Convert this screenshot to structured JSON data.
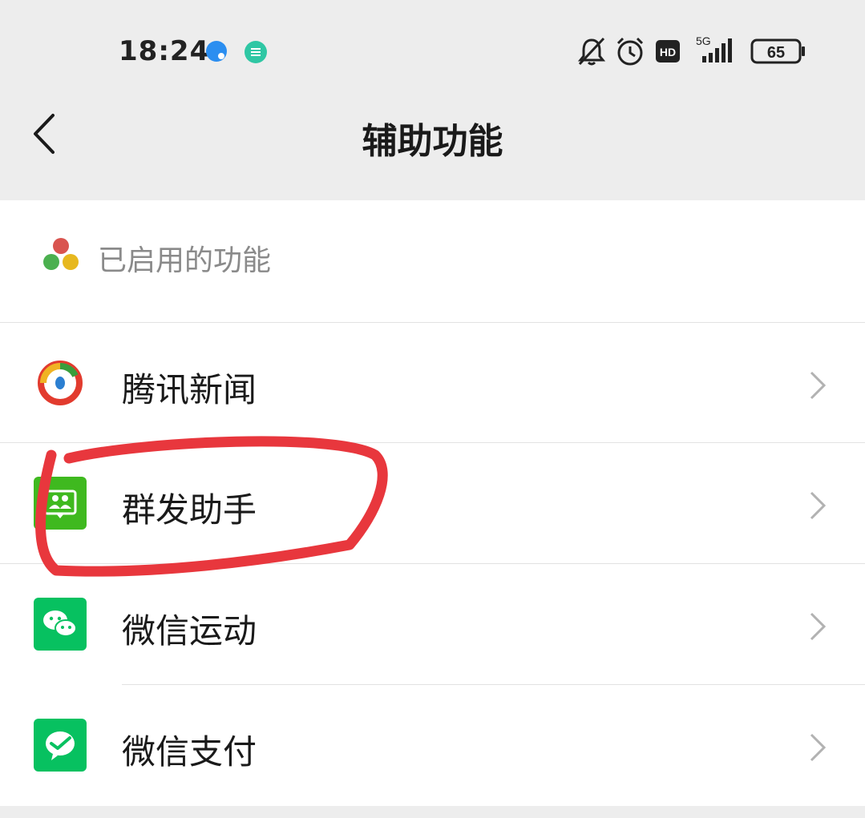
{
  "status_bar": {
    "time": "18:24",
    "network": "5G",
    "battery": "65",
    "hd": "HD",
    "icons": [
      "notification-bubble-icon",
      "message-icon",
      "bell-off-icon",
      "alarm-icon",
      "hd-icon",
      "signal-icon",
      "battery-icon"
    ]
  },
  "header": {
    "title": "辅助功能",
    "back_icon": "back-chevron-icon"
  },
  "section": {
    "label": "已启用的功能",
    "icon": "enabled-features-icon"
  },
  "items": [
    {
      "label": "腾讯新闻",
      "icon": "tencent-news-icon"
    },
    {
      "label": "群发助手",
      "icon": "group-broadcast-icon"
    },
    {
      "label": "微信运动",
      "icon": "wechat-sports-icon"
    },
    {
      "label": "微信支付",
      "icon": "wechat-pay-icon"
    }
  ],
  "colors": {
    "background": "#ededed",
    "card": "#ffffff",
    "wechat_green": "#07c160",
    "group_green": "#3fb91f",
    "annotation_red": "#e8373d"
  }
}
